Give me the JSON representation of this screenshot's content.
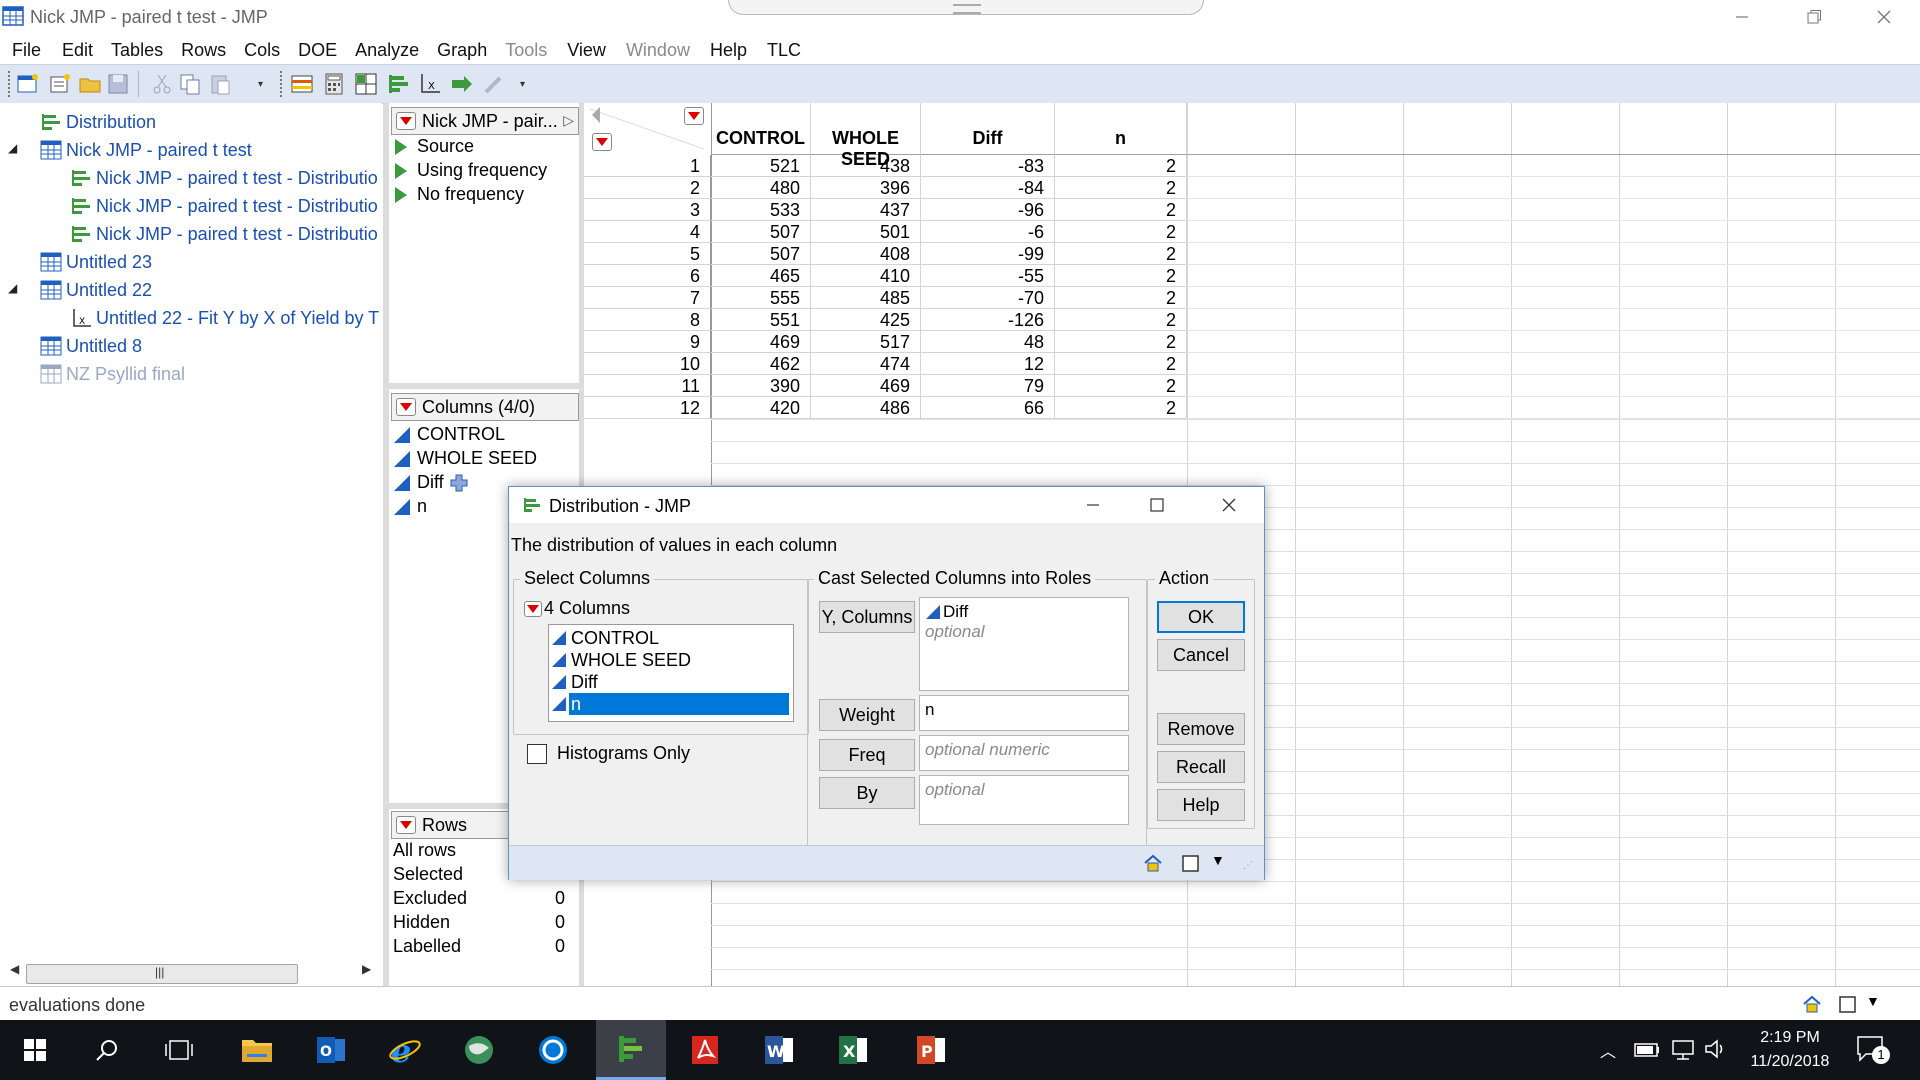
{
  "window": {
    "title": "Nick JMP - paired t test - JMP"
  },
  "menus": [
    "File",
    "Edit",
    "Tables",
    "Rows",
    "Cols",
    "DOE",
    "Analyze",
    "Graph",
    "Tools",
    "View",
    "Window",
    "Help",
    "TLC"
  ],
  "menus_disabled": [
    "Tools",
    "Window"
  ],
  "tree": {
    "items": [
      {
        "label": "Distribution"
      },
      {
        "label": "Nick JMP - paired t test"
      },
      {
        "label": "Nick JMP - paired t test - Distributio"
      },
      {
        "label": "Nick JMP - paired t test - Distributio"
      },
      {
        "label": "Nick JMP - paired t test - Distributio"
      },
      {
        "label": "Untitled 23"
      },
      {
        "label": "Untitled 22"
      },
      {
        "label": "Untitled 22 - Fit Y by X of Yield by T"
      },
      {
        "label": "Untitled 8"
      },
      {
        "label": "NZ Psyllid final"
      }
    ]
  },
  "table_panel": {
    "title": "Nick JMP - pair...",
    "scripts": [
      "Source",
      "Using frequency",
      "No frequency"
    ],
    "columns_header": "Columns (4/0)",
    "columns": [
      "CONTROL",
      "WHOLE SEED",
      "Diff",
      "n"
    ],
    "rows_header": "Rows",
    "rows_stats": [
      {
        "label": "All rows",
        "value": ""
      },
      {
        "label": "Selected",
        "value": ""
      },
      {
        "label": "Excluded",
        "value": "0"
      },
      {
        "label": "Hidden",
        "value": "0"
      },
      {
        "label": "Labelled",
        "value": "0"
      }
    ]
  },
  "grid": {
    "headers": [
      "CONTROL",
      "WHOLE SEED",
      "Diff",
      "n"
    ],
    "rows": [
      [
        "1",
        "521",
        "438",
        "-83",
        "2"
      ],
      [
        "2",
        "480",
        "396",
        "-84",
        "2"
      ],
      [
        "3",
        "533",
        "437",
        "-96",
        "2"
      ],
      [
        "4",
        "507",
        "501",
        "-6",
        "2"
      ],
      [
        "5",
        "507",
        "408",
        "-99",
        "2"
      ],
      [
        "6",
        "465",
        "410",
        "-55",
        "2"
      ],
      [
        "7",
        "555",
        "485",
        "-70",
        "2"
      ],
      [
        "8",
        "551",
        "425",
        "-126",
        "2"
      ],
      [
        "9",
        "469",
        "517",
        "48",
        "2"
      ],
      [
        "10",
        "462",
        "474",
        "12",
        "2"
      ],
      [
        "11",
        "390",
        "469",
        "79",
        "2"
      ],
      [
        "12",
        "420",
        "486",
        "66",
        "2"
      ]
    ]
  },
  "dialog": {
    "title": "Distribution - JMP",
    "description": "The distribution of values in each column",
    "select_columns_label": "Select Columns",
    "columns_count": "4 Columns",
    "column_list": [
      "CONTROL",
      "WHOLE SEED",
      "Diff",
      "n"
    ],
    "selected_column": "n",
    "histograms_only": "Histograms Only",
    "cast_label": "Cast Selected Columns into Roles",
    "roles": {
      "y_button": "Y, Columns",
      "y_value": "Diff",
      "y_optional": "optional",
      "weight_button": "Weight",
      "weight_value": "n",
      "freq_button": "Freq",
      "freq_placeholder": "optional numeric",
      "by_button": "By",
      "by_placeholder": "optional"
    },
    "action_label": "Action",
    "actions": {
      "ok": "OK",
      "cancel": "Cancel",
      "remove": "Remove",
      "recall": "Recall",
      "help": "Help"
    }
  },
  "statusbar": {
    "text": "evaluations done"
  },
  "taskbar": {
    "time": "2:19 PM",
    "date": "11/20/2018",
    "notifications": "1"
  },
  "colors": {
    "accent": "#0078d7",
    "link": "#1a4fb4",
    "toolbar": "#dfe6f3",
    "taskbar": "#101418"
  }
}
